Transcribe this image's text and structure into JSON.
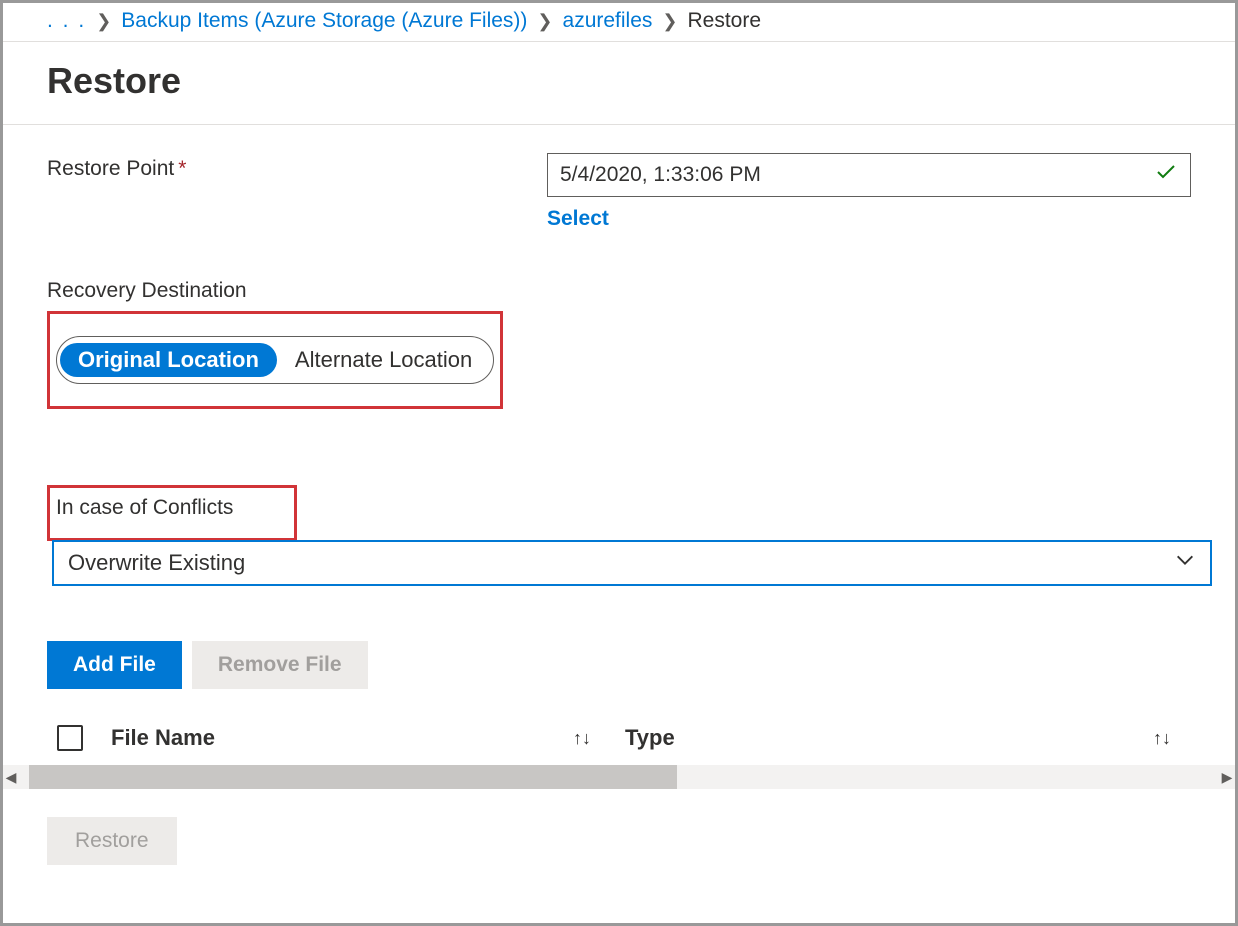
{
  "breadcrumb": {
    "ellipsis": ". . .",
    "item1": "Backup Items (Azure Storage (Azure Files))",
    "item2": "azurefiles",
    "current": "Restore"
  },
  "title": "Restore",
  "restorePoint": {
    "label": "Restore Point",
    "value": "5/4/2020, 1:33:06 PM",
    "selectLabel": "Select"
  },
  "recoveryDestination": {
    "label": "Recovery Destination",
    "option1": "Original Location",
    "option2": "Alternate Location"
  },
  "conflicts": {
    "label": "In case of Conflicts",
    "value": "Overwrite Existing"
  },
  "buttons": {
    "addFile": "Add File",
    "removeFile": "Remove File",
    "restore": "Restore"
  },
  "table": {
    "col1": "File Name",
    "col2": "Type"
  }
}
